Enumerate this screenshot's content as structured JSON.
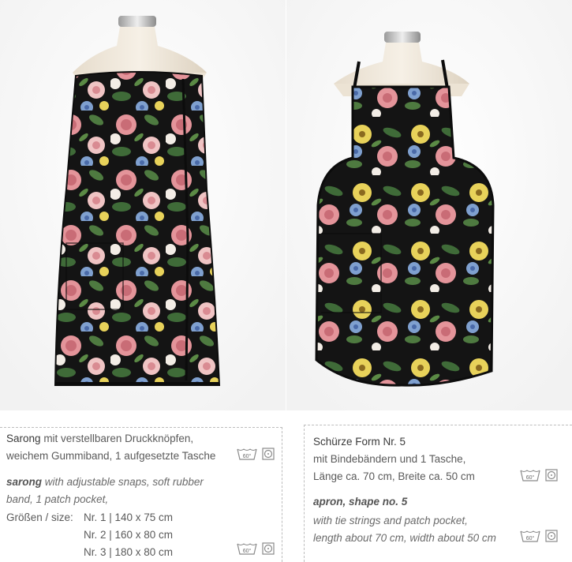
{
  "sarong": {
    "title": "Sarong",
    "desc_de_1": "mit verstellbaren Druckknöpfen,",
    "desc_de_2": "weichem Gummiband, 1 aufgesetzte Tasche",
    "title_en": "sarong",
    "desc_en_1": "with adjustable snaps, soft rubber",
    "desc_en_2": "band, 1 patch pocket,",
    "size_label": "Größen / size:",
    "sizes": [
      "Nr. 1 | 140 x 75 cm",
      "Nr. 2 | 160 x 80 cm",
      "Nr. 3 | 180 x 80 cm"
    ]
  },
  "apron": {
    "title": "Schürze Form Nr. 5",
    "desc_de_1": "mit Bindebändern und 1 Tasche,",
    "desc_de_2": "Länge ca. 70 cm, Breite ca. 50 cm",
    "title_en": "apron, shape no. 5",
    "desc_en_1": "with tie strings and patch pocket,",
    "desc_en_2": "length about 70 cm, width about 50 cm"
  },
  "care_icons": {
    "wash_label": "60°",
    "wash_icon": "wash-60-icon",
    "dryer_icon": "tumble-dryer-icon"
  },
  "colors": {
    "fabric_black": "#141414",
    "rose_pink": "#e4949a",
    "blue_flower": "#7fa0cf",
    "yellow_flower": "#e8d25a",
    "leaf_green": "#3f6b38",
    "text": "#5a5a5a"
  }
}
